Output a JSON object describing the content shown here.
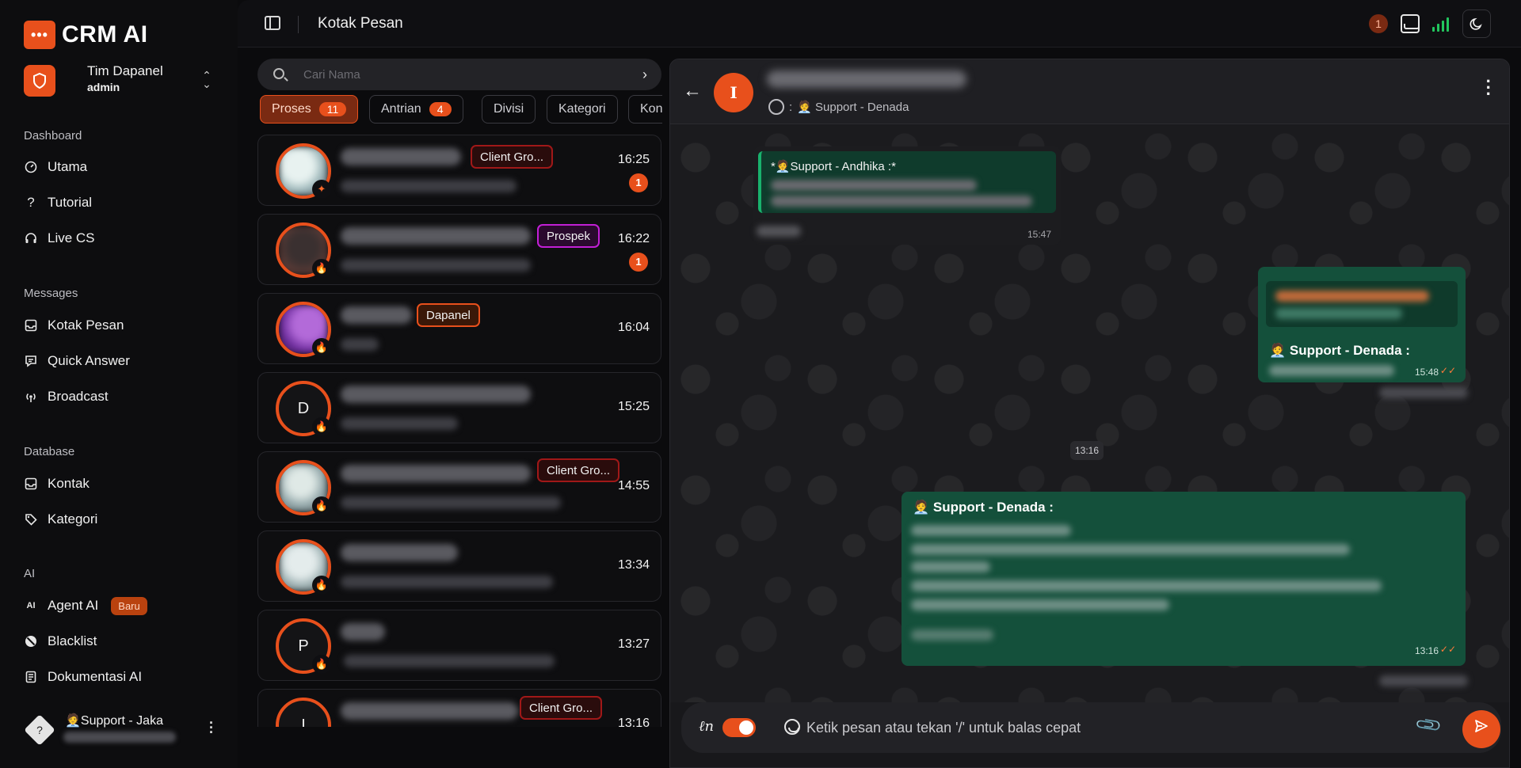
{
  "sidebar": {
    "brand": {
      "logo_text": "•••",
      "name": "CRM AI"
    },
    "team": {
      "name": "Tim Dapanel",
      "role": "admin"
    },
    "sections": {
      "dashboard": "Dashboard",
      "messages": "Messages",
      "database": "Database",
      "ai": "AI"
    },
    "items": {
      "utama": "Utama",
      "tutorial": "Tutorial",
      "live_cs": "Live CS",
      "kotak_pesan": "Kotak Pesan",
      "quick_answer": "Quick Answer",
      "broadcast": "Broadcast",
      "kontak": "Kontak",
      "kategori": "Kategori",
      "agent_ai": "Agent AI",
      "agent_ai_badge": "Baru",
      "blacklist": "Blacklist",
      "dokumentasi_ai": "Dokumentasi AI"
    },
    "user": {
      "avatar_glyph": "?",
      "name": "🧑‍💼Support - Jaka"
    }
  },
  "topbar": {
    "title": "Kotak Pesan",
    "notification_count": "1"
  },
  "list": {
    "search_placeholder": "Cari Nama",
    "tabs": [
      {
        "label": "Proses",
        "count": "11"
      },
      {
        "label": "Antrian",
        "count": "4"
      },
      {
        "label": "Divisi"
      },
      {
        "label": "Kategori"
      },
      {
        "label": "Kon"
      }
    ],
    "chats": [
      {
        "tag": "Client Gro...",
        "tag_type": "group",
        "time": "16:25",
        "unread": "1"
      },
      {
        "tag": "Prospek",
        "tag_type": "prospek",
        "time": "16:22",
        "unread": "1"
      },
      {
        "tag": "Dapanel",
        "tag_type": "dapanel",
        "time": "16:04"
      },
      {
        "avatar_letter": "D",
        "time": "15:25"
      },
      {
        "tag": "Client Gro...",
        "tag_type": "group",
        "time": "14:55"
      },
      {
        "time": "13:34"
      },
      {
        "avatar_letter": "P",
        "time": "13:27"
      },
      {
        "avatar_letter": "I",
        "tag": "Client Gro...",
        "tag_type": "group",
        "time": "13:16"
      }
    ]
  },
  "chat": {
    "avatar_letter": "I",
    "assignee": "🧑‍💼 Support - Denada",
    "assignee_prefix": ":",
    "messages": {
      "incoming_quote_title": "*🧑‍💼Support - Andhika :*",
      "incoming_time": "15:47",
      "out1_sender": "🧑‍💼 Support - Denada :",
      "out1_time": "15:48",
      "date_chip": "13:16",
      "out2_sender": "🧑‍💼 Support - Denada :",
      "out2_time": "13:16",
      "tick_glyph": "✓✓"
    },
    "composer": {
      "placeholder": "Ketik pesan atau tekan '/' untuk balas cepat"
    }
  },
  "colors": {
    "accent": "#e8501c",
    "bubble_out": "#14503b",
    "quote_in": "#0f3b2c",
    "tag_group": "#a01818",
    "tag_prospek": "#c21fd6",
    "online": "#22c55e"
  }
}
